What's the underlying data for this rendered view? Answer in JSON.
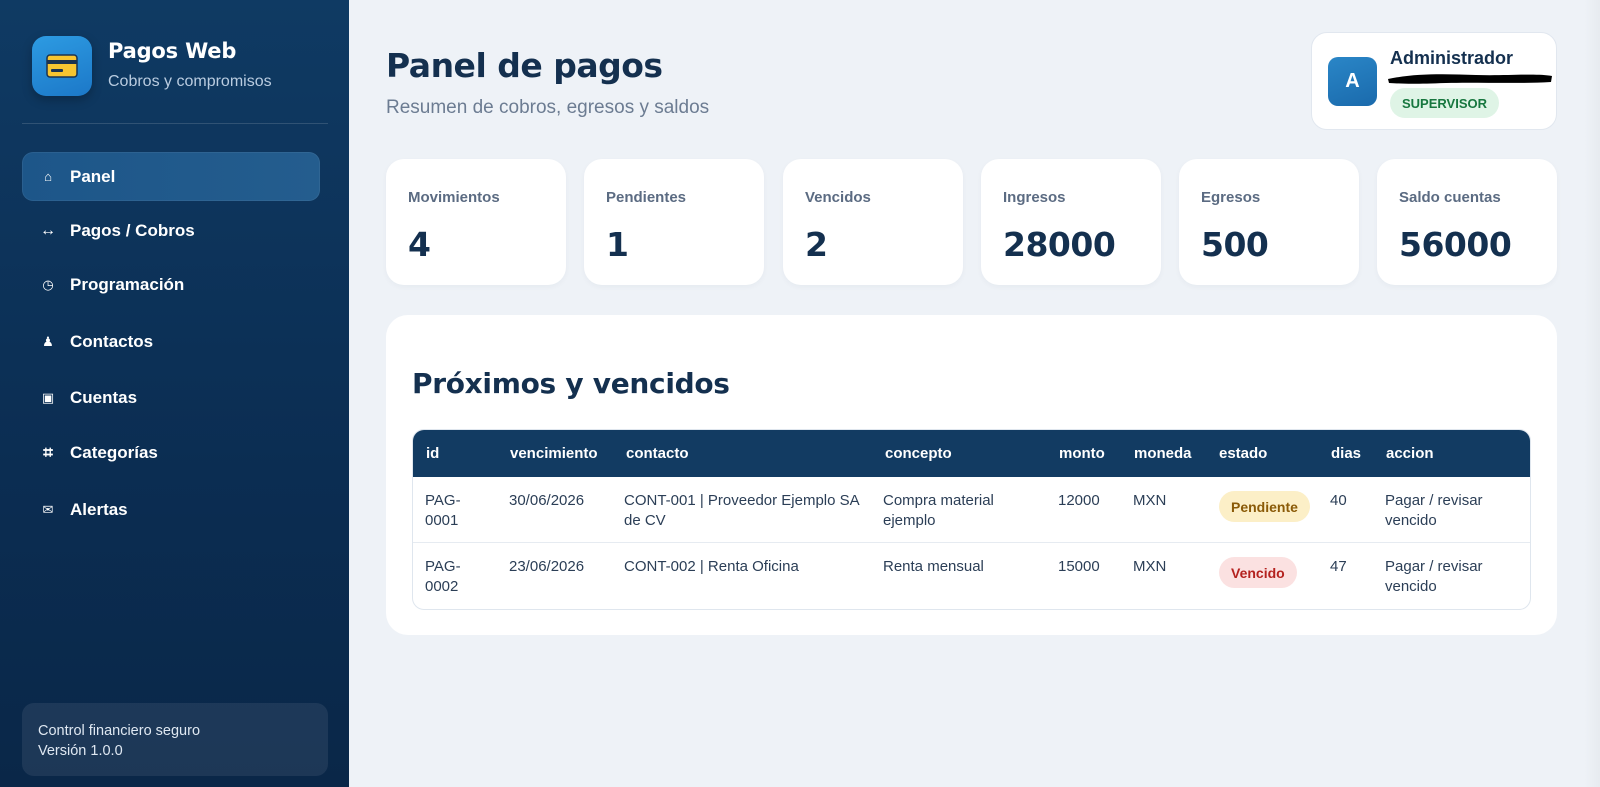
{
  "app": {
    "title": "Pagos Web",
    "subtitle": "Cobros y compromisos"
  },
  "sidebar": {
    "items": [
      {
        "label": "Panel",
        "icon": "home-icon",
        "glyph": "⌂",
        "active": true
      },
      {
        "label": "Pagos / Cobros",
        "icon": "arrows-icon",
        "glyph": "↔",
        "active": false
      },
      {
        "label": "Programación",
        "icon": "clock-icon",
        "glyph": "◷",
        "active": false
      },
      {
        "label": "Contactos",
        "icon": "person-icon",
        "glyph": "♟",
        "active": false
      },
      {
        "label": "Cuentas",
        "icon": "account-icon",
        "glyph": "▣",
        "active": false
      },
      {
        "label": "Categorías",
        "icon": "hash-icon",
        "glyph": "⌗",
        "active": false
      },
      {
        "label": "Alertas",
        "icon": "mail-icon",
        "glyph": "✉",
        "active": false
      }
    ],
    "footer": {
      "line1": "Control financiero seguro",
      "line2": "Versión 1.0.0"
    }
  },
  "header": {
    "title": "Panel de pagos",
    "subtitle": "Resumen de cobros, egresos y saldos"
  },
  "user": {
    "avatar_letter": "A",
    "name": "Administrador",
    "role": "SUPERVISOR"
  },
  "stats": [
    {
      "label": "Movimientos",
      "value": "4"
    },
    {
      "label": "Pendientes",
      "value": "1"
    },
    {
      "label": "Vencidos",
      "value": "2"
    },
    {
      "label": "Ingresos",
      "value": "28000"
    },
    {
      "label": "Egresos",
      "value": "500"
    },
    {
      "label": "Saldo cuentas",
      "value": "56000"
    }
  ],
  "upcoming": {
    "title": "Próximos y vencidos",
    "columns": [
      "id",
      "vencimiento",
      "contacto",
      "concepto",
      "monto",
      "moneda",
      "estado",
      "dias",
      "accion"
    ],
    "rows": [
      {
        "id": "PAG-0001",
        "id_line1": "PAG-",
        "id_line2": "0001",
        "vencimiento": "30/06/2026",
        "contacto_line1": "CONT-001 | Proveedor Ejemplo SA",
        "contacto_line2": "de CV",
        "concepto_line1": "Compra material",
        "concepto_line2": "ejemplo",
        "monto": "12000",
        "moneda": "MXN",
        "estado": "Pendiente",
        "dias": "40",
        "accion_line1": "Pagar / revisar",
        "accion_line2": "vencido"
      },
      {
        "id": "PAG-0002",
        "id_line1": "PAG-",
        "id_line2": "0002",
        "vencimiento": "23/06/2026",
        "contacto_line1": "CONT-002 | Renta Oficina",
        "contacto_line2": "",
        "concepto_line1": "Renta mensual",
        "concepto_line2": "",
        "monto": "15000",
        "moneda": "MXN",
        "estado": "Vencido",
        "dias": "47",
        "accion_line1": "Pagar / revisar",
        "accion_line2": "vencido"
      }
    ]
  },
  "colors": {
    "sidebar": "#0f3a63",
    "accent": "#1c78c8",
    "table_header": "#123b62",
    "pending": "#fcefc7",
    "overdue": "#fbe1e1",
    "role_badge": "#dff4e6"
  }
}
